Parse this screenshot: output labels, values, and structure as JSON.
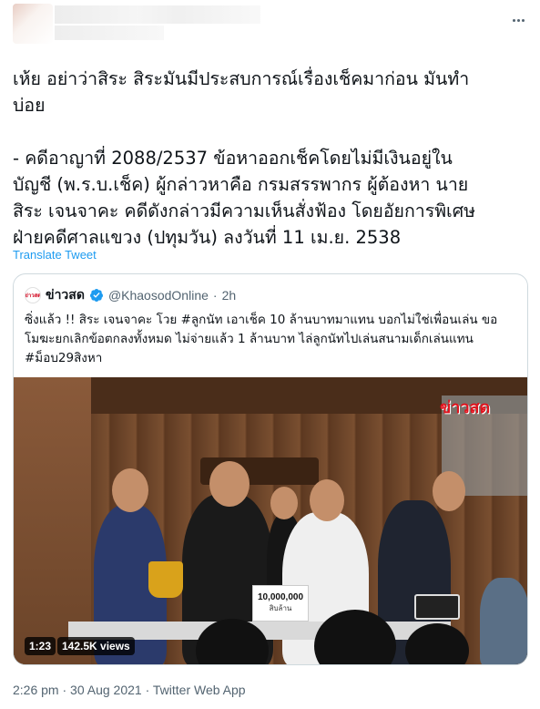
{
  "tweet": {
    "text": "เห้ย อย่าว่าสิระ สิระมันมีประสบการณ์เรื่องเช็คมาก่อน มันทำ\nบ่อย\n\n- คดีอาญาที่ 2088/2537 ข้อหาออกเช็คโดยไม่มีเงินอยู่ใน\nบัญชี (พ.ร.บ.เช็ค) ผู้กล่าวหาคือ กรมสรรพากร ผู้ต้องหา นาย\nสิระ เจนจาคะ คดีดังกล่าวมีความเห็นสั่งฟ้อง โดยอัยการพิเศษ\nฝ่ายคดีศาลแขวง (ปทุมวัน) ลงวันที่ 11 เม.ย. 2538",
    "translate_label": "Translate Tweet",
    "time": "2:26 pm",
    "separator": "·",
    "date": "30 Aug 2021",
    "source": "Twitter Web App",
    "more_icon": "more-horizontal-icon"
  },
  "quote": {
    "name": "ข่าวสด",
    "logo_text": "ข่าวสด",
    "handle": "@KhaosodOnline",
    "dot": "·",
    "age": "2h",
    "text": "ซิ่งแล้ว !! สิระ เจนจาคะ โวย #ลูกนัท เอาเช็ค 10 ล้านบาทมาแทน บอกไม่ใช่เพื่อนเล่น ขอ\nโมฆะยกเลิกข้อตกลงทั้งหมด ไม่จ่ายแล้ว 1 ล้านบาท ไล่ลูกนัทไปเล่นสนามเด็กเล่นแทน\n#ม็อบ29สิงหา",
    "video": {
      "duration": "1:23",
      "views": "142.5K views",
      "watermark": "ข่าวสด",
      "sign_amount": "10,000,000",
      "sign_caption": "สิบล้าน"
    }
  },
  "colors": {
    "link": "#1d9bf0",
    "muted": "#536471",
    "text": "#0f1419",
    "border": "#cfd9de",
    "verified": "#1d9bf0"
  }
}
